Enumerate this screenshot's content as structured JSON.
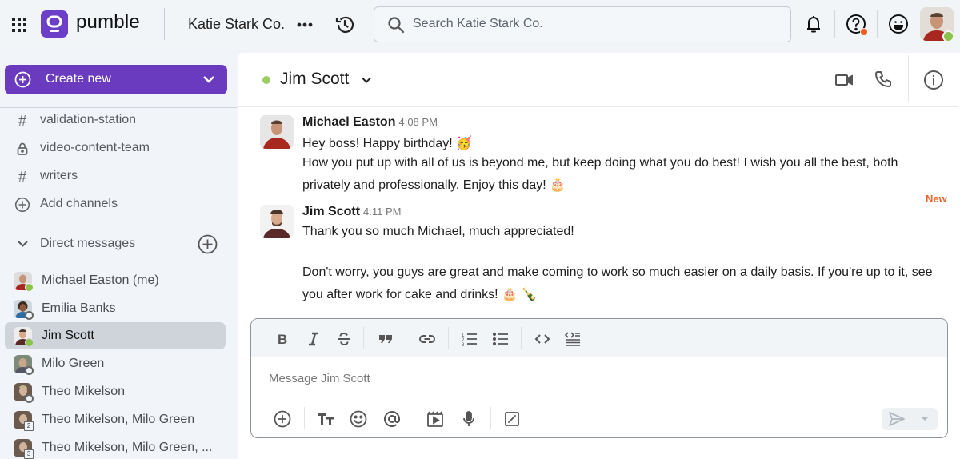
{
  "topbar": {
    "logo_text": "pumble",
    "workspace_name": "Katie Stark Co.",
    "search_placeholder": "Search Katie Stark Co.",
    "icons": [
      "apps-grid-icon",
      "more-icon",
      "history-icon",
      "search-icon",
      "bell-icon",
      "help-icon",
      "emoji-status-icon",
      "profile-avatar"
    ],
    "help_badge_color": "#f05d1e",
    "presence_color": "#8bc34a"
  },
  "sidebar": {
    "create_new_label": "Create new",
    "brand_color": "#6a3bbf",
    "channels": [
      {
        "icon": "hash-icon",
        "label": "validation-station"
      },
      {
        "icon": "lock-icon",
        "label": "video-content-team"
      },
      {
        "icon": "hash-icon",
        "label": "writers"
      },
      {
        "icon": "plus-circle-icon",
        "label": "Add channels"
      }
    ],
    "dm_header": "Direct messages",
    "dms": [
      {
        "label": "Michael Easton (me)",
        "status": "online"
      },
      {
        "label": "Emilia Banks",
        "status": "offline"
      },
      {
        "label": "Jim Scott",
        "status": "online",
        "active": true
      },
      {
        "label": "Milo Green",
        "status": "offline"
      },
      {
        "label": "Theo Mikelson",
        "status": "offline"
      },
      {
        "label": "Theo Mikelson, Milo Green",
        "count": "2"
      },
      {
        "label": "Theo Mikelson, Milo Green, ...",
        "count": "3"
      }
    ]
  },
  "channel": {
    "name": "Jim Scott",
    "status": "online",
    "actions": [
      "video-call-icon",
      "phone-call-icon",
      "info-icon"
    ]
  },
  "messages": [
    {
      "author": "Michael Easton",
      "time": "4:08 PM",
      "lines": [
        "Hey boss! Happy birthday! 🥳",
        "How you put up with all of us is beyond me, but keep doing what you do best! I wish you all the best, both",
        "privately and professionally. Enjoy this day! 🎂"
      ]
    },
    {
      "author": "Jim Scott",
      "time": "4:11 PM",
      "lines": [
        "Thank you so much Michael, much appreciated!",
        "",
        "Don't worry, you guys are great and make coming to work so much easier on a daily basis. If you're up to it, see",
        "you after work for cake and drinks! 🎂 🍾"
      ]
    }
  ],
  "new_divider_label": "New",
  "composer": {
    "placeholder": "Message Jim Scott",
    "format_buttons": [
      "bold",
      "italic",
      "strikethrough",
      "quote",
      "link",
      "ordered-list",
      "bullet-list",
      "code",
      "code-block"
    ],
    "bottom_buttons": [
      "add",
      "text-format",
      "emoji",
      "mention",
      "media",
      "microphone",
      "slash-command"
    ]
  }
}
